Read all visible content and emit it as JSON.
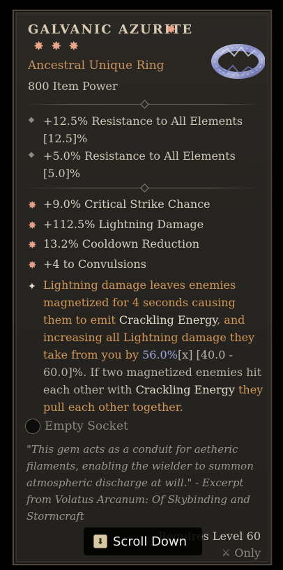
{
  "item": {
    "name": "GALVANIC AZURITE",
    "title_star": "✸",
    "rarity_stars": [
      "✸",
      "✸",
      "✸"
    ],
    "type": "Ancestral Unique Ring",
    "item_power": "800 Item Power"
  },
  "implicits": [
    {
      "line1": "+12.5% Resistance to All Elements",
      "line2": "[12.5]%"
    },
    {
      "line1": "+5.0% Resistance to All Elements",
      "line2": "[5.0]%"
    }
  ],
  "affixes": [
    {
      "icon": "✸",
      "text": "+9.0% Critical Strike Chance"
    },
    {
      "icon": "✸",
      "text": "+112.5% Lightning Damage"
    },
    {
      "icon": "✸",
      "text": "13.2% Cooldown Reduction"
    },
    {
      "icon": "✸",
      "text": "+4 to Convulsions"
    }
  ],
  "unique_power": {
    "icon": "✦",
    "part1": "Lightning damage leaves enemies magnetized for 4 seconds causing them to emit ",
    "kw1": "Crackling Energy",
    "part2": ", and increasing all Lightning damage they take from you by ",
    "value": "56.0%",
    "range": "[x]",
    "part3": " [40.0 - 60.0]%. If two magnetized enemies hit each other with ",
    "kw2": "Crackling Energy",
    "part4": " they pull each other together."
  },
  "socket": {
    "label": "Empty Socket"
  },
  "flavor_text": "\"This gem acts as a conduit for aetheric filaments, enabling the wielder to summon atmospheric discharge at will.\" - Excerpt from Volatus Arcanum: Of Skybinding and Stormcraft",
  "requirements": {
    "level": "Requires Level 60",
    "class_only": "Only"
  },
  "scroll_button": {
    "key": "⬇",
    "label": "Scroll Down"
  },
  "colors": {
    "unique_orange": "#d39758",
    "affix_icon": "#e6a08a",
    "value_blue": "#9fa8e0",
    "panel_bg": "#2b2824"
  }
}
